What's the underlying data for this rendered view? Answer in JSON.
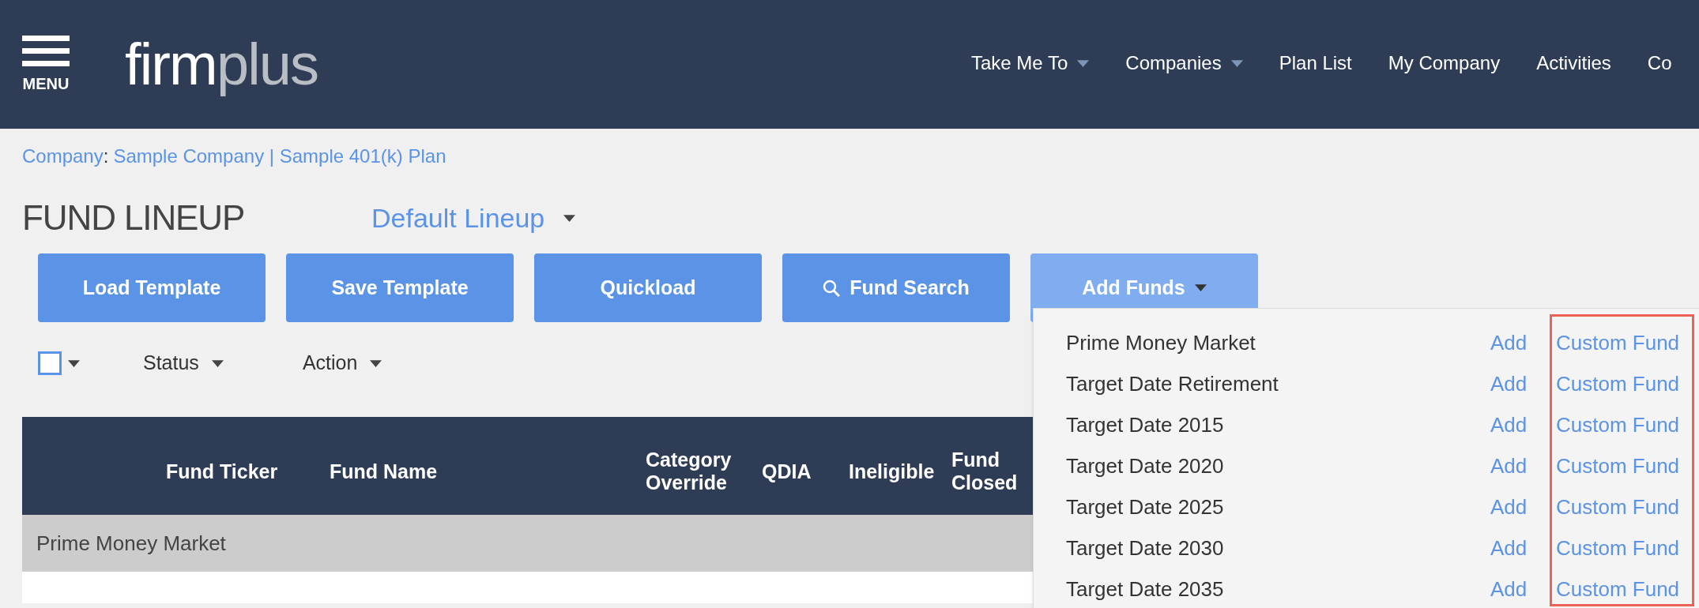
{
  "header": {
    "menu_label": "MENU",
    "logo": "**firm**plus",
    "nav": [
      {
        "label": "Take Me To",
        "has_menu": true
      },
      {
        "label": "Companies",
        "has_menu": true
      },
      {
        "label": "Plan List",
        "has_menu": false
      },
      {
        "label": "My Company",
        "has_menu": false
      },
      {
        "label": "Activities",
        "has_menu": false
      },
      {
        "label": "Co",
        "has_menu": false
      }
    ]
  },
  "breadcrumb": {
    "label": "Company",
    "separator": ":",
    "path": "Sample Company | Sample 401(k) Plan"
  },
  "title": "FUND LINEUP",
  "lineup": "Default Lineup",
  "buttons": [
    {
      "label": "Load Template",
      "kind": "plain"
    },
    {
      "label": "Save Template",
      "kind": "plain"
    },
    {
      "label": "Quickload",
      "kind": "plain"
    },
    {
      "label": "Fund Search",
      "kind": "search"
    },
    {
      "label": "Add Funds",
      "kind": "menu"
    }
  ],
  "filters": {
    "select_all_checked": false,
    "status": "Status",
    "action": "Action"
  },
  "table": {
    "columns": [
      "",
      "Fund Ticker",
      "Fund Name",
      "Category Override",
      "QDIA",
      "Ineligible",
      "Fund Closed"
    ],
    "group": "Prime Money Market"
  },
  "add_funds_menu": {
    "highlight_custom_column": true,
    "items": [
      {
        "name": "Prime Money Market",
        "add": "Add",
        "custom": "Custom Fund"
      },
      {
        "name": "Target Date Retirement",
        "add": "Add",
        "custom": "Custom Fund"
      },
      {
        "name": "Target Date 2015",
        "add": "Add",
        "custom": "Custom Fund"
      },
      {
        "name": "Target Date 2020",
        "add": "Add",
        "custom": "Custom Fund"
      },
      {
        "name": "Target Date 2025",
        "add": "Add",
        "custom": "Custom Fund"
      },
      {
        "name": "Target Date 2030",
        "add": "Add",
        "custom": "Custom Fund"
      },
      {
        "name": "Target Date 2035",
        "add": "Add",
        "custom": "Custom Fund"
      }
    ]
  }
}
